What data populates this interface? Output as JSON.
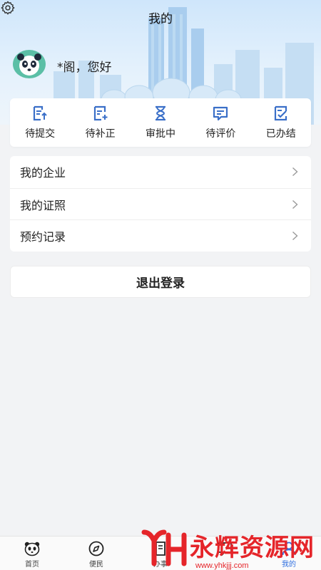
{
  "header": {
    "title": "我的",
    "greeting": "*阁，您好"
  },
  "status": [
    {
      "label": "待提交",
      "icon": "submit-doc-icon"
    },
    {
      "label": "待补正",
      "icon": "supplement-doc-icon"
    },
    {
      "label": "审批中",
      "icon": "hourglass-icon"
    },
    {
      "label": "待评价",
      "icon": "comment-icon"
    },
    {
      "label": "已办结",
      "icon": "done-doc-icon"
    }
  ],
  "menu": [
    {
      "label": "我的企业"
    },
    {
      "label": "我的证照"
    },
    {
      "label": "预约记录"
    }
  ],
  "logout": "退出登录",
  "tabs": [
    {
      "label": "首页",
      "icon": "panda-icon"
    },
    {
      "label": "便民",
      "icon": "compass-icon"
    },
    {
      "label": "办事",
      "icon": "doc-icon"
    },
    {
      "label": "",
      "icon": "chat-icon"
    },
    {
      "label": "我的",
      "icon": "user-icon"
    }
  ],
  "watermark": {
    "text": "永辉资源网",
    "url": "www.yhkjjj.com"
  },
  "colors": {
    "accent": "#2f6fe0",
    "icon": "#3a6fc8",
    "watermark": "#e5252a",
    "avatar": "#5bbfa6"
  }
}
